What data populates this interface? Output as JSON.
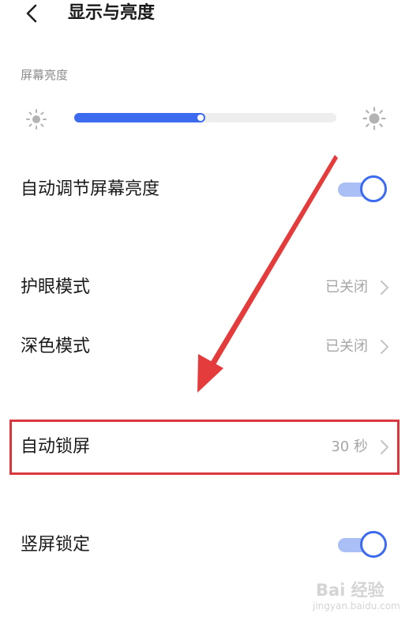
{
  "header": {
    "title": "显示与亮度",
    "back_icon": "chevron-left-icon"
  },
  "brightness": {
    "section_label": "屏幕亮度",
    "level_percent": 50,
    "min_icon": "sun-small-icon",
    "max_icon": "sun-large-icon",
    "accent_color": "#3d6bf0"
  },
  "rows": {
    "auto_brightness": {
      "label": "自动调节屏幕亮度",
      "toggle_on": true
    },
    "eye_care": {
      "label": "护眼模式",
      "value": "已关闭"
    },
    "dark_mode": {
      "label": "深色模式",
      "value": "已关闭"
    },
    "auto_lock": {
      "label": "自动锁屏",
      "value": "30 秒"
    },
    "portrait_lock": {
      "label": "竖屏锁定",
      "toggle_on": true
    }
  },
  "annotation": {
    "highlight_color": "#d9393e"
  },
  "watermark": {
    "main": "Bai 经验",
    "sub": "jingyan.baidu.com"
  }
}
